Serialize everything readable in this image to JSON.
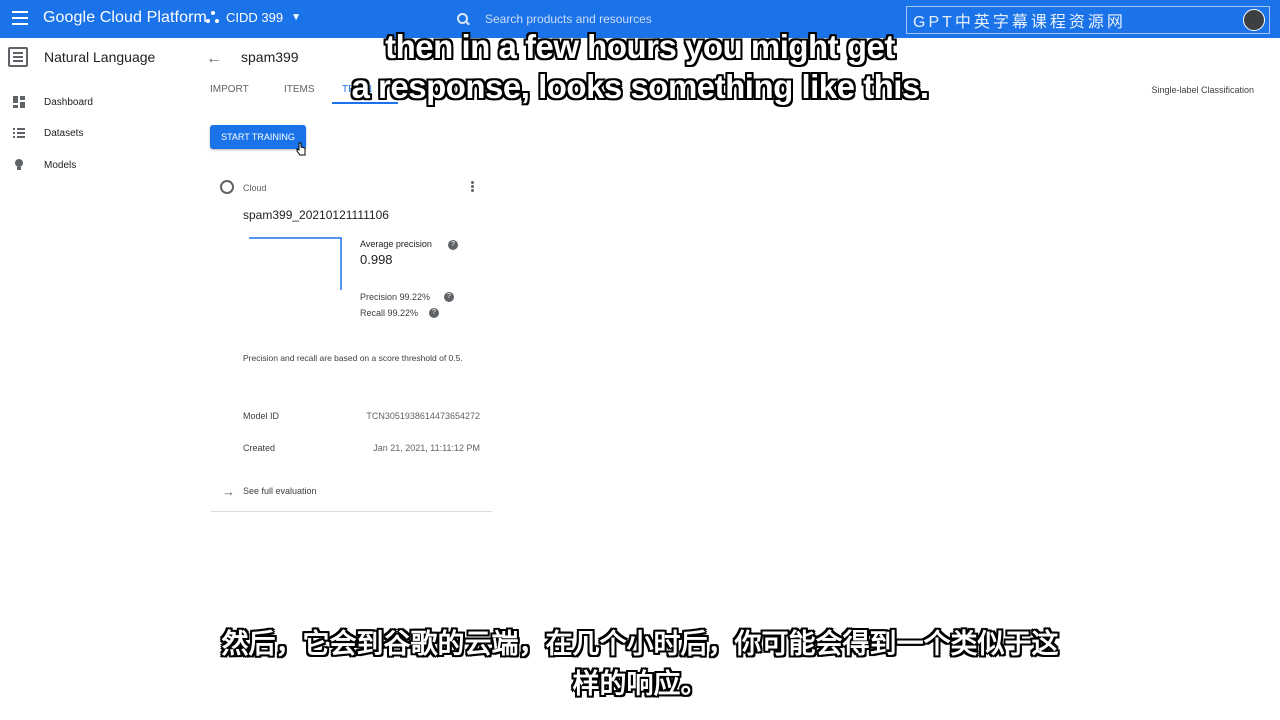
{
  "topbar": {
    "brand": "Google Cloud Platform",
    "project": "CIDD 399",
    "search_placeholder": "Search products and resources",
    "watermark": "GPT中英字幕课程资源网",
    "color": "#1a73e8"
  },
  "sidebar": {
    "title": "Natural Language",
    "items": [
      {
        "label": "Dashboard",
        "icon": "dashboard-icon"
      },
      {
        "label": "Datasets",
        "icon": "list-icon"
      },
      {
        "label": "Models",
        "icon": "lightbulb-icon"
      }
    ]
  },
  "header": {
    "dataset_name": "spam399",
    "tabs": [
      {
        "label": "IMPORT"
      },
      {
        "label": "ITEMS"
      },
      {
        "label": "TRAIN"
      },
      {
        "label": "EVALUATE"
      }
    ],
    "classification": "Single-label Classification"
  },
  "train": {
    "button_label": "START TRAINING"
  },
  "model_card": {
    "location": "Cloud",
    "name": "spam399_20210121111106",
    "average_precision_label": "Average precision",
    "average_precision_value": "0.998",
    "precision": "Precision 99.22%",
    "recall": "Recall 99.22%",
    "threshold_note": "Precision and recall are based on a score threshold of 0.5.",
    "model_id_label": "Model ID",
    "model_id_value": "TCN3051938614473654272",
    "created_label": "Created",
    "created_value": "Jan 21, 2021, 11:11:12 PM",
    "evaluation_link": "See full evaluation"
  },
  "subtitles": {
    "english_line1": "then in a few hours you might get",
    "english_line2": "a response, looks something like this.",
    "chinese_line1": "然后，它会到谷歌的云端，在几个小时后，你可能会得到一个类似于这",
    "chinese_line2": "样的响应。"
  }
}
